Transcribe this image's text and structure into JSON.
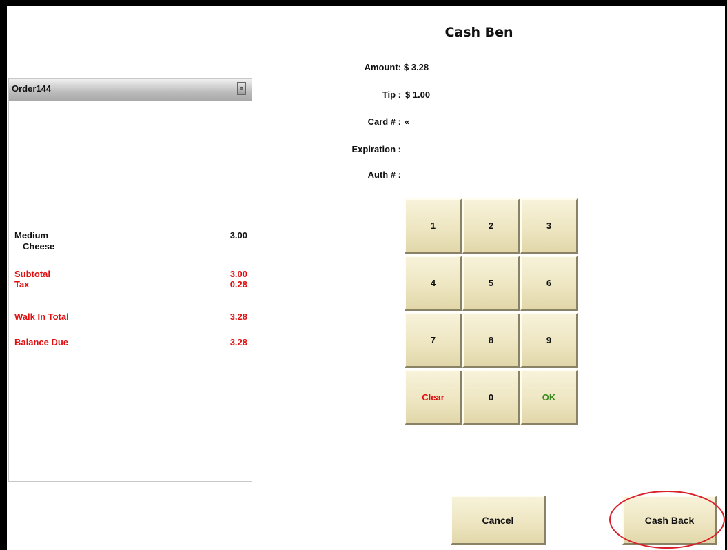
{
  "dialog": {
    "title": "Cash Ben"
  },
  "order": {
    "title": "Order144",
    "scroll_icon": "scroll-button-icon",
    "items": [
      {
        "name": "Medium",
        "price": "3.00",
        "modifier": "Cheese"
      }
    ],
    "subtotal": {
      "label": "Subtotal",
      "value": "3.00"
    },
    "tax": {
      "label": "Tax",
      "value": "0.28"
    },
    "walk_in_total": {
      "label": "Walk In Total",
      "value": "3.28"
    },
    "balance_due": {
      "label": "Balance Due",
      "value": "3.28"
    }
  },
  "payment": {
    "amount": {
      "label": "Amount:",
      "value": "$ 3.28"
    },
    "tip": {
      "label": "Tip :",
      "value": "$ 1.00"
    },
    "card": {
      "label": "Card # :",
      "value": "«"
    },
    "expiration": {
      "label": "Expiration :",
      "value": ""
    },
    "auth": {
      "label": "Auth # :",
      "value": ""
    }
  },
  "keypad": {
    "keys": [
      "1",
      "2",
      "3",
      "4",
      "5",
      "6",
      "7",
      "8",
      "9",
      "Clear",
      "0",
      "OK"
    ]
  },
  "actions": {
    "cancel": "Cancel",
    "cash_back": "Cash Back"
  },
  "colors": {
    "total_lines": "#e01010",
    "ok_key": "#3b8a21",
    "button_face": "#eee6c2",
    "highlight": "#d8202a"
  }
}
